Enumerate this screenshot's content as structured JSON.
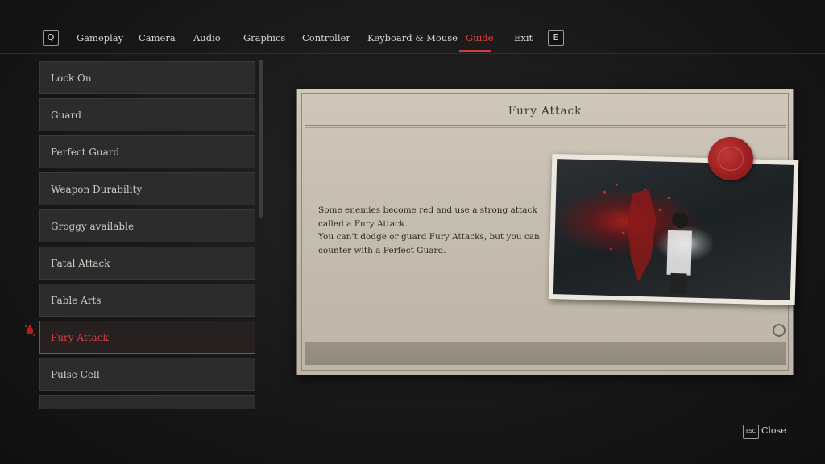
{
  "nav": {
    "prev_key": "Q",
    "next_key": "E",
    "tabs": [
      {
        "label": "Gameplay"
      },
      {
        "label": "Camera"
      },
      {
        "label": "Audio"
      },
      {
        "label": "Graphics"
      },
      {
        "label": "Controller"
      },
      {
        "label": "Keyboard & Mouse"
      },
      {
        "label": "Guide"
      },
      {
        "label": "Exit"
      }
    ],
    "active_tab": "Guide",
    "accent_color": "#d43a3a"
  },
  "guide_list": {
    "items": [
      {
        "label": "Lock On"
      },
      {
        "label": "Guard"
      },
      {
        "label": "Perfect Guard"
      },
      {
        "label": "Weapon Durability"
      },
      {
        "label": "Groggy available"
      },
      {
        "label": "Fatal Attack"
      },
      {
        "label": "Fable Arts"
      },
      {
        "label": "Fury Attack"
      },
      {
        "label": "Pulse Cell"
      }
    ],
    "selected": "Fury Attack"
  },
  "panel": {
    "title": "Fury Attack",
    "description_lines": [
      "Some enemies become red and use a strong attack",
      "called a Fury Attack.",
      "You can’t dodge or guard Fury Attacks, but you can",
      "counter with a Perfect Guard."
    ]
  },
  "footer": {
    "close_key": "ESC",
    "close_label": "Close"
  }
}
